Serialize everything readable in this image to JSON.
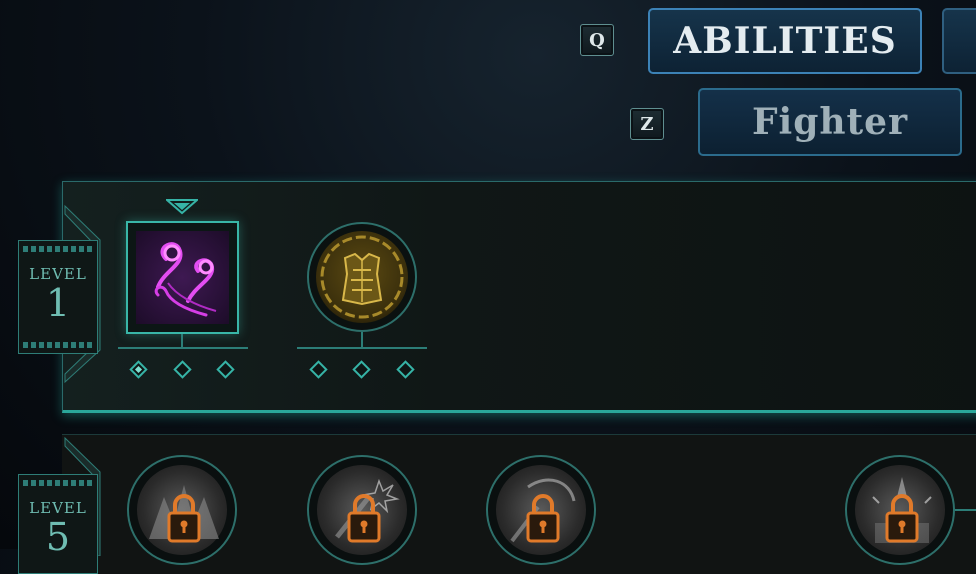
{
  "hotkeys": {
    "tab_cycle": "Q",
    "class_cycle": "Z"
  },
  "tabs": {
    "abilities": "ABILITIES",
    "class_name": "Fighter"
  },
  "levels": [
    {
      "label": "LEVEL",
      "number": "1"
    },
    {
      "label": "LEVEL",
      "number": "5"
    }
  ],
  "level1_slots": [
    {
      "icon": "purple-swirl-ability-icon",
      "type": "square",
      "selected": true,
      "ranks_filled": 1,
      "ranks_total": 3
    },
    {
      "icon": "gold-armor-passive-icon",
      "type": "round",
      "selected": false,
      "ranks_filled": 0,
      "ranks_total": 3
    }
  ],
  "level5_slots": [
    {
      "icon": "locked-ability-icon",
      "locked": true
    },
    {
      "icon": "locked-ability-icon",
      "locked": true
    },
    {
      "icon": "locked-ability-icon",
      "locked": true
    },
    {
      "icon": "locked-ability-icon",
      "locked": true
    }
  ],
  "colors": {
    "accent_teal": "#36b3a6",
    "tab_blue": "#3c82b6",
    "lock_orange": "#e07a2a",
    "gold": "#c9a640",
    "purple": "#d63ee6"
  }
}
